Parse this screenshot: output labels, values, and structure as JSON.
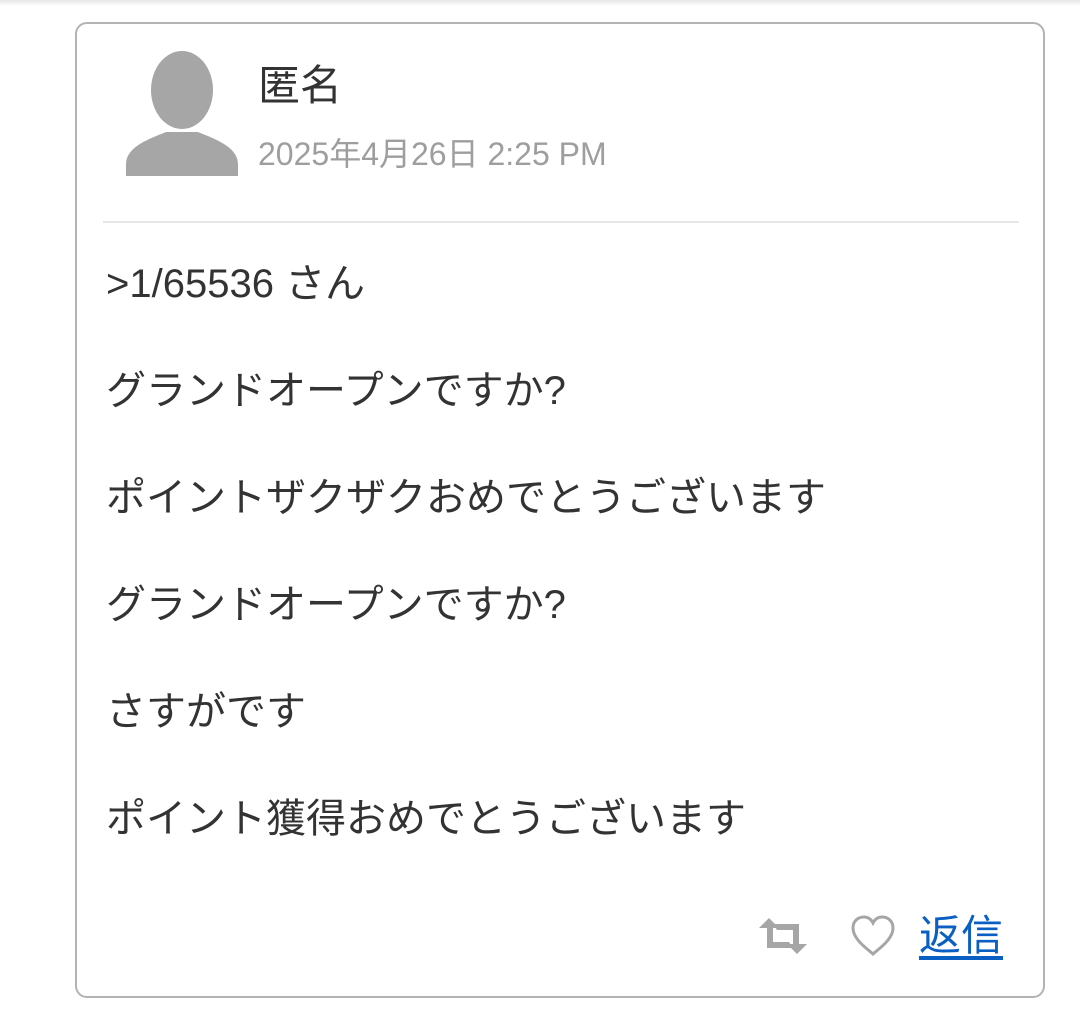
{
  "post": {
    "author": "匿名",
    "timestamp": "2025年4月26日 2:25 PM",
    "lines": [
      ">1/65536 さん",
      "グランドオープンですか?",
      "ポイントザクザクおめでとうございます",
      "グランドオープンですか?",
      "さすがです",
      "ポイント獲得おめでとうございます"
    ]
  },
  "actions": {
    "reply_label": "返信",
    "retweet_icon": "retweet-icon",
    "like_icon": "heart-icon"
  },
  "colors": {
    "text": "#333333",
    "muted": "#9e9e9e",
    "link": "#0a5fc2",
    "icon": "#a6a6a6",
    "border": "#b3b3b3"
  }
}
